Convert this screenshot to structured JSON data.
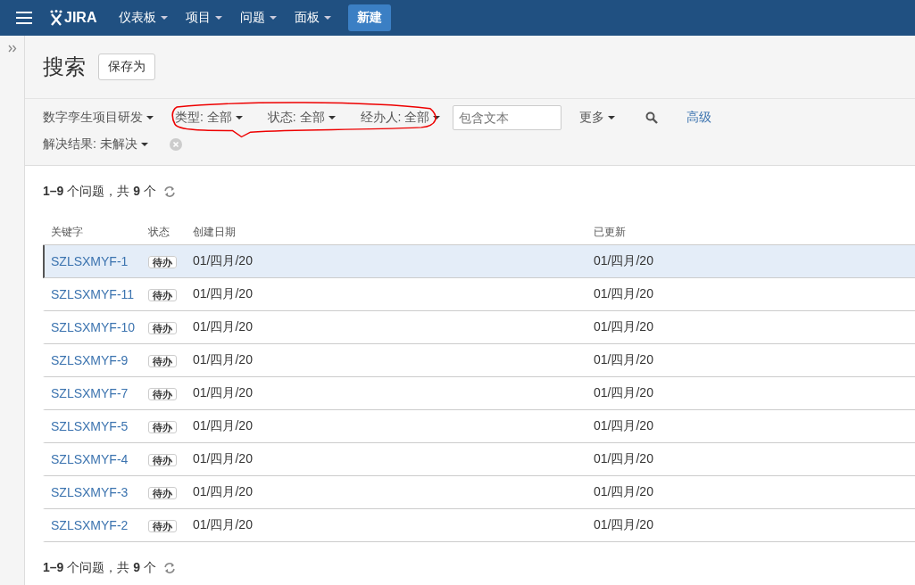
{
  "topbar": {
    "logo": "JIRA",
    "menus": [
      {
        "label": "仪表板"
      },
      {
        "label": "项目"
      },
      {
        "label": "问题"
      },
      {
        "label": "面板"
      }
    ],
    "create_button": "新建"
  },
  "header": {
    "title": "搜索",
    "save_button": "保存为"
  },
  "filters": {
    "items": [
      {
        "label": "数字孪生项目研发"
      },
      {
        "label": "类型: 全部"
      },
      {
        "label": "状态: 全部"
      },
      {
        "label": "经办人: 全部"
      }
    ],
    "search": {
      "placeholder": "包含文本"
    },
    "more": "更多",
    "advanced": "高级",
    "resolution": "解决结果: 未解决"
  },
  "count_top": "**1–9** 个问题，共 **9** 个",
  "table": {
    "columns": [
      "关键字",
      "状态",
      "创建日期",
      "已更新"
    ],
    "rows": [
      {
        "key": "SZLSXMYF-1",
        "status": "待办",
        "created": "01/四月/20",
        "updated": "01/四月/20",
        "selected": true
      },
      {
        "key": "SZLSXMYF-11",
        "status": "待办",
        "created": "01/四月/20",
        "updated": "01/四月/20",
        "selected": false
      },
      {
        "key": "SZLSXMYF-10",
        "status": "待办",
        "created": "01/四月/20",
        "updated": "01/四月/20",
        "selected": false
      },
      {
        "key": "SZLSXMYF-9",
        "status": "待办",
        "created": "01/四月/20",
        "updated": "01/四月/20",
        "selected": false
      },
      {
        "key": "SZLSXMYF-7",
        "status": "待办",
        "created": "01/四月/20",
        "updated": "01/四月/20",
        "selected": false
      },
      {
        "key": "SZLSXMYF-5",
        "status": "待办",
        "created": "01/四月/20",
        "updated": "01/四月/20",
        "selected": false
      },
      {
        "key": "SZLSXMYF-4",
        "status": "待办",
        "created": "01/四月/20",
        "updated": "01/四月/20",
        "selected": false
      },
      {
        "key": "SZLSXMYF-3",
        "status": "待办",
        "created": "01/四月/20",
        "updated": "01/四月/20",
        "selected": false
      },
      {
        "key": "SZLSXMYF-2",
        "status": "待办",
        "created": "01/四月/20",
        "updated": "01/四月/20",
        "selected": false
      }
    ]
  },
  "count_bottom": "**1–9** 个问题，共 **9** 个"
}
